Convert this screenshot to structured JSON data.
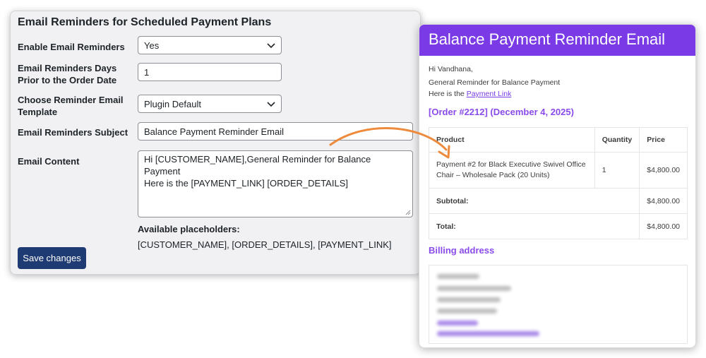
{
  "settings": {
    "title": "Email Reminders for Scheduled Payment Plans",
    "enable_label": "Enable Email Reminders",
    "enable_value": "Yes",
    "days_label": "Email Reminders Days Prior to the Order Date",
    "days_value": "1",
    "template_label": "Choose Reminder Email Template",
    "template_value": "Plugin Default",
    "subject_label": "Email Reminders Subject",
    "subject_value": "Balance Payment Reminder Email",
    "content_label": "Email Content",
    "content_value": "Hi [CUSTOMER_NAME],General Reminder for Balance Payment\nHere is the [PAYMENT_LINK] [ORDER_DETAILS]",
    "placeholders_title": "Available placeholders:",
    "placeholders_list": "[CUSTOMER_NAME], [ORDER_DETAILS], [PAYMENT_LINK]",
    "save_label": "Save changes"
  },
  "email": {
    "header_title": "Balance Payment Reminder Email",
    "greeting": "Hi Vandhana,",
    "reminder_line": "General Reminder for Balance Payment",
    "link_prefix": "Here is the ",
    "link_text": "Payment Link",
    "order_heading": "[Order #2212] (December 4, 2025)",
    "table": {
      "headers": [
        "Product",
        "Quantity",
        "Price"
      ],
      "item": {
        "product": "Payment #2 for Black Executive Swivel Office Chair – Wholesale Pack (20 Units)",
        "quantity": "1",
        "price": "$4,800.00"
      },
      "subtotal_label": "Subtotal:",
      "subtotal_value": "$4,800.00",
      "total_label": "Total:",
      "total_value": "$4,800.00"
    },
    "billing_heading": "Billing address"
  },
  "colors": {
    "email_accent": "#7a3be6",
    "save_button": "#1f3b73",
    "arrow": "#ee8a3c"
  },
  "icons": [
    "chevron-down-icon",
    "resize-handle-icon",
    "curved-arrow-icon"
  ]
}
